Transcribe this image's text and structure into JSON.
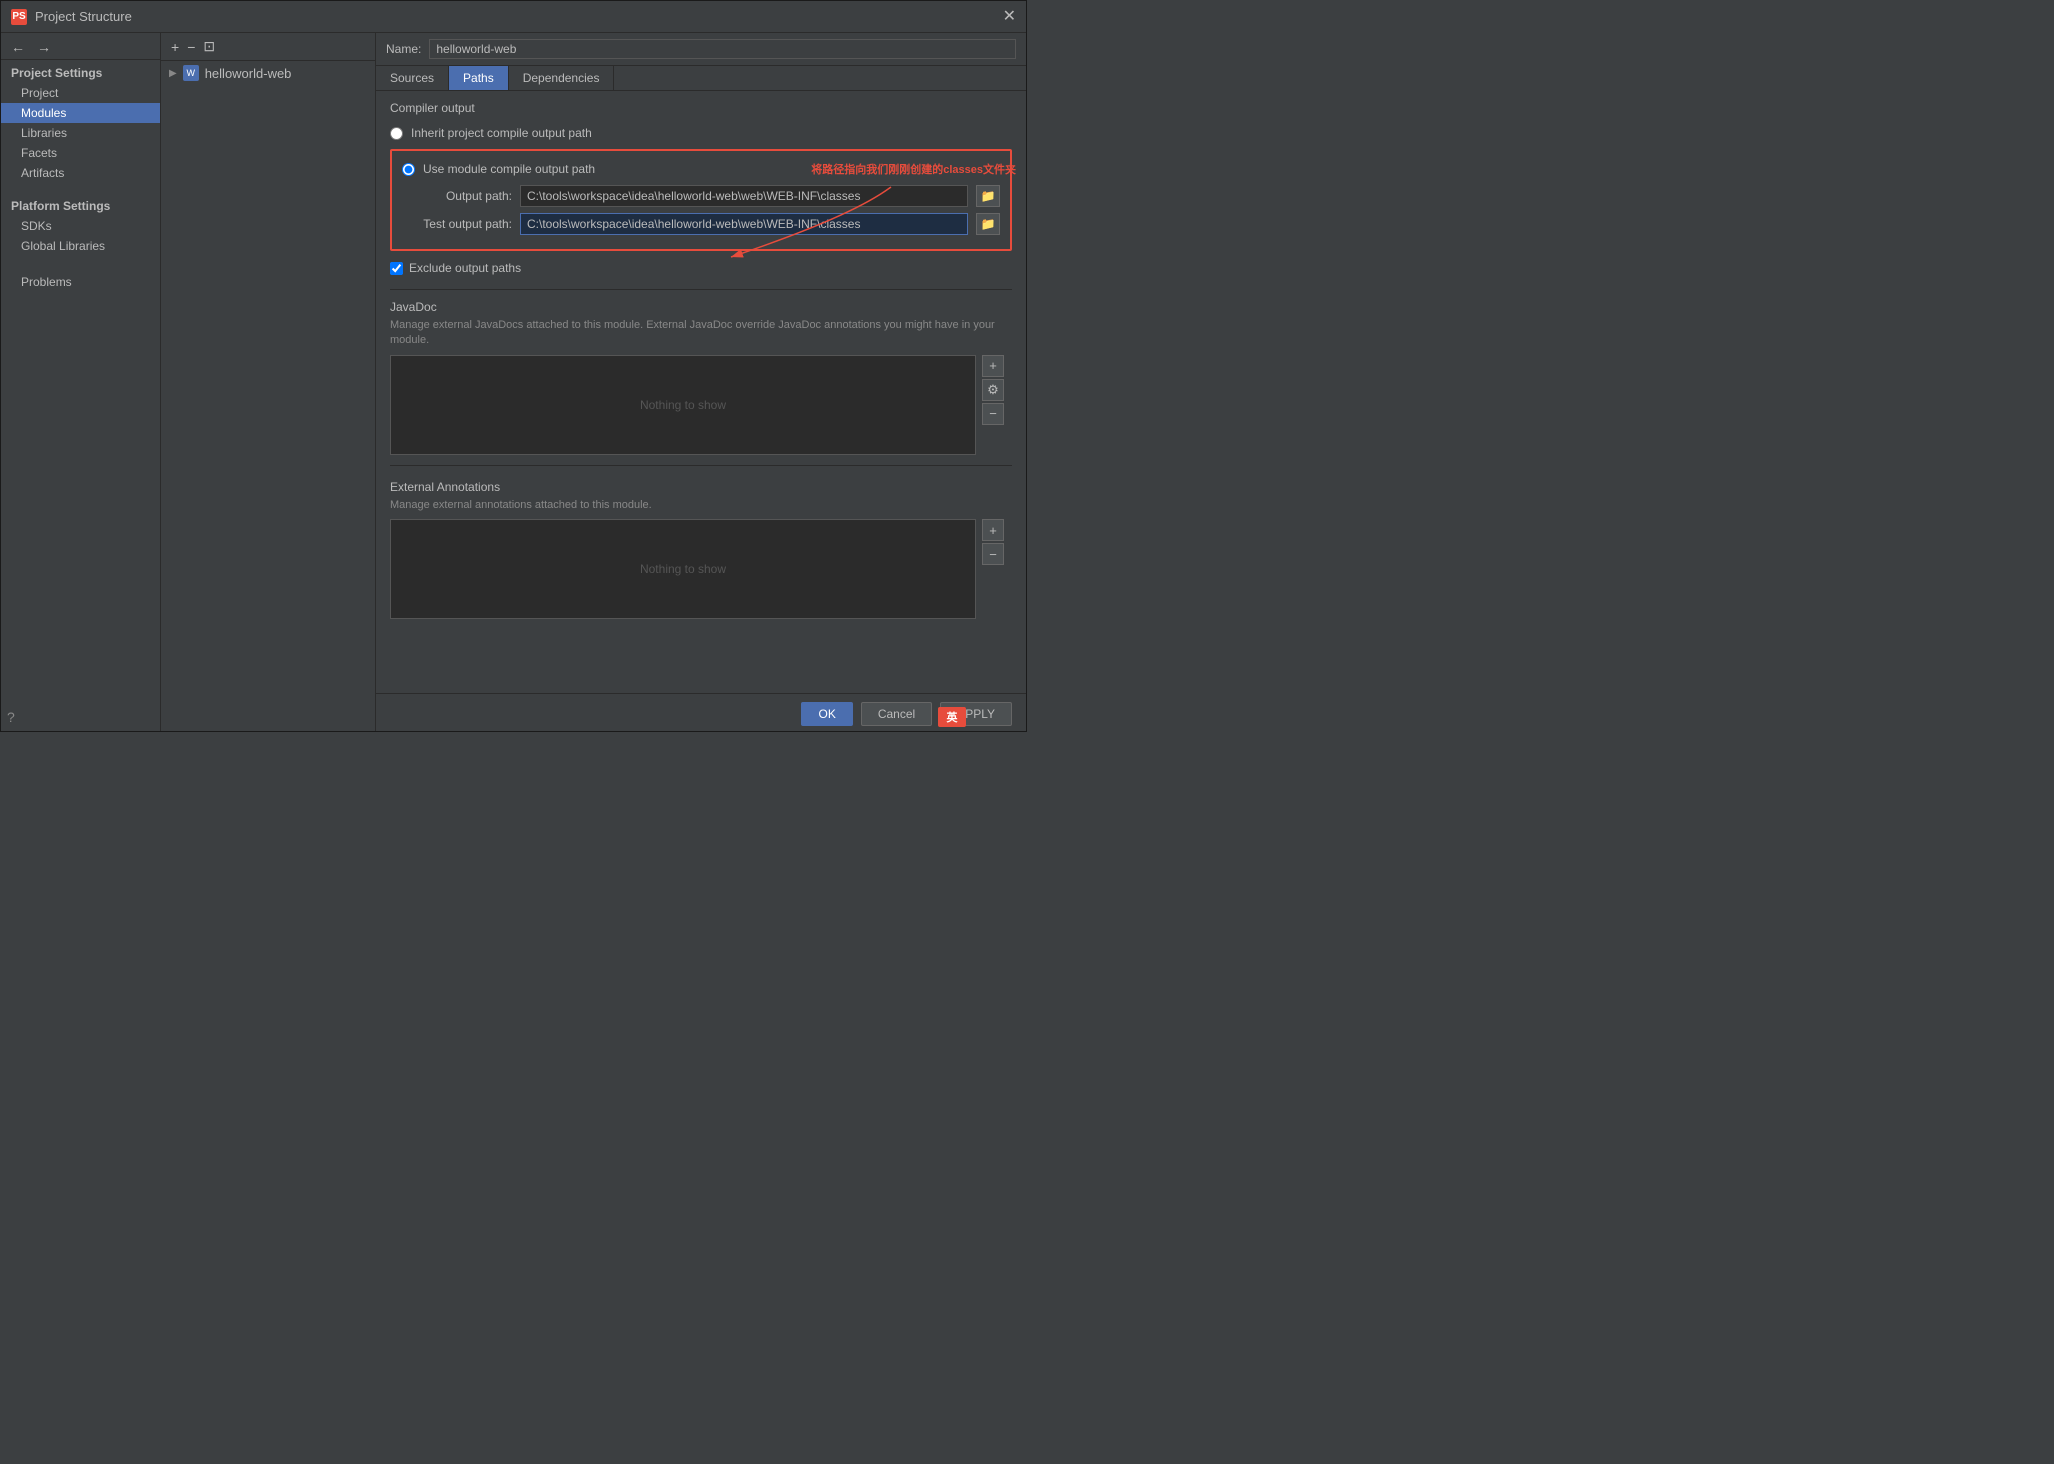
{
  "window": {
    "title": "Project Structure",
    "icon": "PS"
  },
  "nav": {
    "back_label": "←",
    "forward_label": "→"
  },
  "module_toolbar": {
    "add_label": "+",
    "remove_label": "−",
    "copy_label": "⊡"
  },
  "module_item": {
    "name": "helloworld-web",
    "arrow": "▶"
  },
  "sidebar": {
    "project_settings_header": "Project Settings",
    "items": [
      {
        "id": "project",
        "label": "Project"
      },
      {
        "id": "modules",
        "label": "Modules",
        "active": true
      },
      {
        "id": "libraries",
        "label": "Libraries"
      },
      {
        "id": "facets",
        "label": "Facets"
      },
      {
        "id": "artifacts",
        "label": "Artifacts"
      }
    ],
    "platform_settings_header": "Platform Settings",
    "platform_items": [
      {
        "id": "sdks",
        "label": "SDKs"
      },
      {
        "id": "global-libraries",
        "label": "Global Libraries"
      }
    ],
    "problems": "Problems"
  },
  "name_bar": {
    "label": "Name:",
    "value": "helloworld-web"
  },
  "tabs": [
    {
      "id": "sources",
      "label": "Sources"
    },
    {
      "id": "paths",
      "label": "Paths",
      "active": true
    },
    {
      "id": "dependencies",
      "label": "Dependencies"
    }
  ],
  "paths": {
    "compiler_output_label": "Compiler output",
    "inherit_option": "Inherit project compile output path",
    "use_module_option": "Use module compile output path",
    "output_path_label": "Output path:",
    "output_path_value": "C:\\tools\\workspace\\idea\\helloworld-web\\web\\WEB-INF\\classes",
    "test_output_path_label": "Test output path:",
    "test_output_path_value": "C:\\tools\\workspace\\idea\\helloworld-web\\web\\WEB-INF\\classes",
    "exclude_label": "Exclude output paths",
    "browse_icon": "📁"
  },
  "javadoc": {
    "title": "JavaDoc",
    "description": "Manage external JavaDocs attached to this module. External JavaDoc override JavaDoc annotations you might have in your module.",
    "nothing_to_show": "Nothing to show",
    "add_icon": "+",
    "settings_icon": "⚙",
    "remove_icon": "−"
  },
  "external_annotations": {
    "title": "External Annotations",
    "description": "Manage external annotations attached to this module.",
    "nothing_to_show": "Nothing to show",
    "add_icon": "+",
    "remove_icon": "−"
  },
  "annotation": {
    "text": "将路径指向我们刚刚创建的classes文件夹"
  },
  "bottom_buttons": {
    "ok": "OK",
    "cancel": "Cancel",
    "apply": "APPLY"
  },
  "status_bar": {
    "lang_label": "英"
  }
}
